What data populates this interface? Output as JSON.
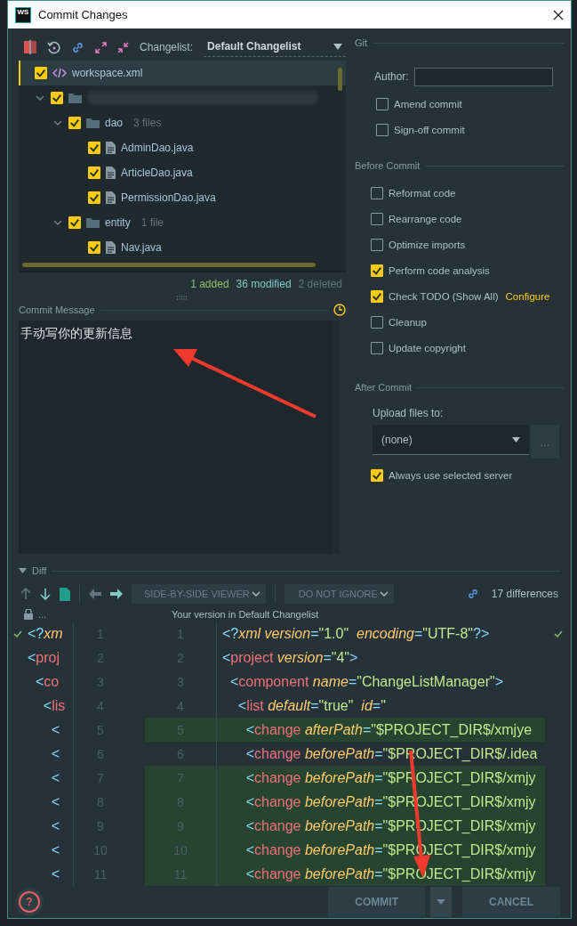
{
  "window": {
    "app_icon": "WS",
    "title": "Commit Changes"
  },
  "changes": {
    "changelist_label": "Changelist:",
    "changelist": "Default Changelist",
    "tree": [
      {
        "kind": "xml",
        "name": "workspace.xml",
        "checked": true,
        "selected": true
      },
      {
        "kind": "folder",
        "checked": true,
        "expanded": true,
        "selected": false,
        "children": [
          {
            "kind": "folder",
            "name": "dao",
            "count": "3 files",
            "checked": true,
            "expanded": true,
            "selected": false,
            "children": [
              {
                "kind": "java",
                "name": "AdminDao.java",
                "checked": true,
                "selected": false
              },
              {
                "kind": "java",
                "name": "ArticleDao.java",
                "checked": true,
                "selected": false
              },
              {
                "kind": "java",
                "name": "PermissionDao.java",
                "checked": true,
                "selected": false
              }
            ]
          },
          {
            "kind": "folder",
            "name": "entity",
            "count": "1 file",
            "checked": true,
            "expanded": true,
            "selected": false,
            "children": [
              {
                "kind": "java",
                "name": "Nav.java",
                "checked": true,
                "selected": false
              }
            ]
          }
        ]
      }
    ],
    "stats": [
      {
        "text": "1 added",
        "color": "#8fbf6a"
      },
      {
        "text": "36 modified",
        "color": "#80cbc4"
      },
      {
        "text": "2 deleted",
        "color": "#65737e"
      }
    ]
  },
  "commit_message": {
    "label": "Commit Message",
    "value": "手动写你的更新信息"
  },
  "git": {
    "title": "Git",
    "author_label": "Author:",
    "options": [
      {
        "label": "Amend commit",
        "checked": false
      },
      {
        "label": "Sign-off commit",
        "checked": false
      }
    ]
  },
  "before_commit": {
    "title": "Before Commit",
    "options": [
      {
        "label": "Reformat code",
        "checked": false
      },
      {
        "label": "Rearrange code",
        "checked": false
      },
      {
        "label": "Optimize imports",
        "checked": false
      },
      {
        "label": "Perform code analysis",
        "checked": true
      },
      {
        "label": "Check TODO (Show All)",
        "checked": true,
        "link": "Configure"
      },
      {
        "label": "Cleanup",
        "checked": false
      },
      {
        "label": "Update copyright",
        "checked": false
      }
    ]
  },
  "after_commit": {
    "title": "After Commit",
    "upload_label": "Upload files to:",
    "server": "(none)",
    "browse": "...",
    "options": [
      {
        "label": "Always use selected server",
        "checked": true
      }
    ]
  },
  "diff": {
    "title": "Diff",
    "viewer": "SIDE-BY-SIDE VIEWER",
    "ignore": "DO NOT IGNORE",
    "differences": "17 differences",
    "left_caption": "...",
    "caption": "Your version in Default Changelist",
    "lines": [
      {
        "left_num": "1",
        "right_num": "1",
        "changed": false,
        "left": [
          {
            "kind": "punct",
            "text": "<?"
          },
          {
            "kind": "attr",
            "text": "xm"
          }
        ],
        "right": [
          {
            "kind": "punct",
            "text": "<?"
          },
          {
            "kind": "attr",
            "text": "xml version"
          },
          {
            "kind": "punct",
            "text": "="
          },
          {
            "kind": "value",
            "text": "\"1.0\""
          },
          {
            "kind": "attr",
            "text": "  encoding"
          },
          {
            "kind": "punct",
            "text": "="
          },
          {
            "kind": "value",
            "text": "\"UTF-8\""
          },
          {
            "kind": "punct",
            "text": "?>"
          }
        ]
      },
      {
        "left_num": "2",
        "right_num": "2",
        "changed": false,
        "left": [
          {
            "kind": "punct",
            "text": "<"
          },
          {
            "kind": "tag",
            "text": "proj"
          }
        ],
        "right": [
          {
            "kind": "punct",
            "text": "<"
          },
          {
            "kind": "tag",
            "text": "project"
          },
          {
            "kind": "attr",
            "text": " version"
          },
          {
            "kind": "punct",
            "text": "="
          },
          {
            "kind": "value",
            "text": "\"4\""
          },
          {
            "kind": "punct",
            "text": ">"
          }
        ]
      },
      {
        "left_num": "3",
        "right_num": "3",
        "changed": false,
        "left": [
          {
            "kind": "punct",
            "text": "  <"
          },
          {
            "kind": "tag",
            "text": "co"
          }
        ],
        "right": [
          {
            "kind": "punct",
            "text": "  <"
          },
          {
            "kind": "tag",
            "text": "component"
          },
          {
            "kind": "attr",
            "text": " name"
          },
          {
            "kind": "punct",
            "text": "="
          },
          {
            "kind": "value",
            "text": "\"ChangeListManager\""
          },
          {
            "kind": "punct",
            "text": ">"
          }
        ]
      },
      {
        "left_num": "4",
        "right_num": "4",
        "changed": false,
        "left": [
          {
            "kind": "punct",
            "text": "    <"
          },
          {
            "kind": "tag",
            "text": "lis"
          }
        ],
        "right": [
          {
            "kind": "punct",
            "text": "    <"
          },
          {
            "kind": "tag",
            "text": "list"
          },
          {
            "kind": "attr",
            "text": " default"
          },
          {
            "kind": "punct",
            "text": "="
          },
          {
            "kind": "value",
            "text": "\"true\""
          },
          {
            "kind": "attr",
            "text": "  id"
          },
          {
            "kind": "punct",
            "text": "="
          },
          {
            "kind": "value",
            "text": "\""
          }
        ]
      },
      {
        "left_num": "5",
        "right_num": "5",
        "changed": true,
        "left": [
          {
            "kind": "punct",
            "text": "      <"
          }
        ],
        "right": [
          {
            "kind": "punct",
            "text": "      <"
          },
          {
            "kind": "tag",
            "text": "change"
          },
          {
            "kind": "attr",
            "text": " afterPath"
          },
          {
            "kind": "punct",
            "text": "="
          },
          {
            "kind": "value",
            "text": "\"$PROJECT_DIR$/xmjye"
          }
        ]
      },
      {
        "left_num": "6",
        "right_num": "6",
        "changed": false,
        "left": [
          {
            "kind": "punct",
            "text": "      <"
          }
        ],
        "right": [
          {
            "kind": "punct",
            "text": "      <"
          },
          {
            "kind": "tag",
            "text": "change"
          },
          {
            "kind": "attr",
            "text": " beforePath"
          },
          {
            "kind": "punct",
            "text": "="
          },
          {
            "kind": "value",
            "text": "\"$PROJECT_DIR$/.idea"
          }
        ]
      },
      {
        "left_num": "7",
        "right_num": "7",
        "changed": true,
        "left": [
          {
            "kind": "punct",
            "text": "      <"
          }
        ],
        "right": [
          {
            "kind": "punct",
            "text": "      <"
          },
          {
            "kind": "tag",
            "text": "change"
          },
          {
            "kind": "attr",
            "text": " beforePath"
          },
          {
            "kind": "punct",
            "text": "="
          },
          {
            "kind": "value",
            "text": "\"$PROJECT_DIR$/xmjy"
          }
        ]
      },
      {
        "left_num": "8",
        "right_num": "8",
        "changed": true,
        "left": [
          {
            "kind": "punct",
            "text": "      <"
          }
        ],
        "right": [
          {
            "kind": "punct",
            "text": "      <"
          },
          {
            "kind": "tag",
            "text": "change"
          },
          {
            "kind": "attr",
            "text": " beforePath"
          },
          {
            "kind": "punct",
            "text": "="
          },
          {
            "kind": "value",
            "text": "\"$PROJECT_DIR$/xmjy"
          }
        ]
      },
      {
        "left_num": "9",
        "right_num": "9",
        "changed": true,
        "left": [
          {
            "kind": "punct",
            "text": "      <"
          }
        ],
        "right": [
          {
            "kind": "punct",
            "text": "      <"
          },
          {
            "kind": "tag",
            "text": "change"
          },
          {
            "kind": "attr",
            "text": " beforePath"
          },
          {
            "kind": "punct",
            "text": "="
          },
          {
            "kind": "value",
            "text": "\"$PROJECT_DIR$/xmjy"
          }
        ]
      },
      {
        "left_num": "10",
        "right_num": "10",
        "changed": true,
        "left": [
          {
            "kind": "punct",
            "text": "      <"
          }
        ],
        "right": [
          {
            "kind": "punct",
            "text": "      <"
          },
          {
            "kind": "tag",
            "text": "change"
          },
          {
            "kind": "attr",
            "text": " beforePath"
          },
          {
            "kind": "punct",
            "text": "="
          },
          {
            "kind": "value",
            "text": "\"$PROJECT_DIR$/xmjy"
          }
        ]
      },
      {
        "left_num": "11",
        "right_num": "11",
        "changed": true,
        "left": [
          {
            "kind": "punct",
            "text": "      <"
          }
        ],
        "right": [
          {
            "kind": "punct",
            "text": "      <"
          },
          {
            "kind": "tag",
            "text": "change"
          },
          {
            "kind": "attr",
            "text": " beforePath"
          },
          {
            "kind": "punct",
            "text": "="
          },
          {
            "kind": "value",
            "text": "\"$PROJECT_DIR$/xmjy"
          }
        ]
      }
    ]
  },
  "footer": {
    "help": "?",
    "buttons": [
      {
        "kind": "primary",
        "label": "COMMIT"
      },
      {
        "kind": "secondary",
        "label": "CANCEL"
      }
    ]
  }
}
